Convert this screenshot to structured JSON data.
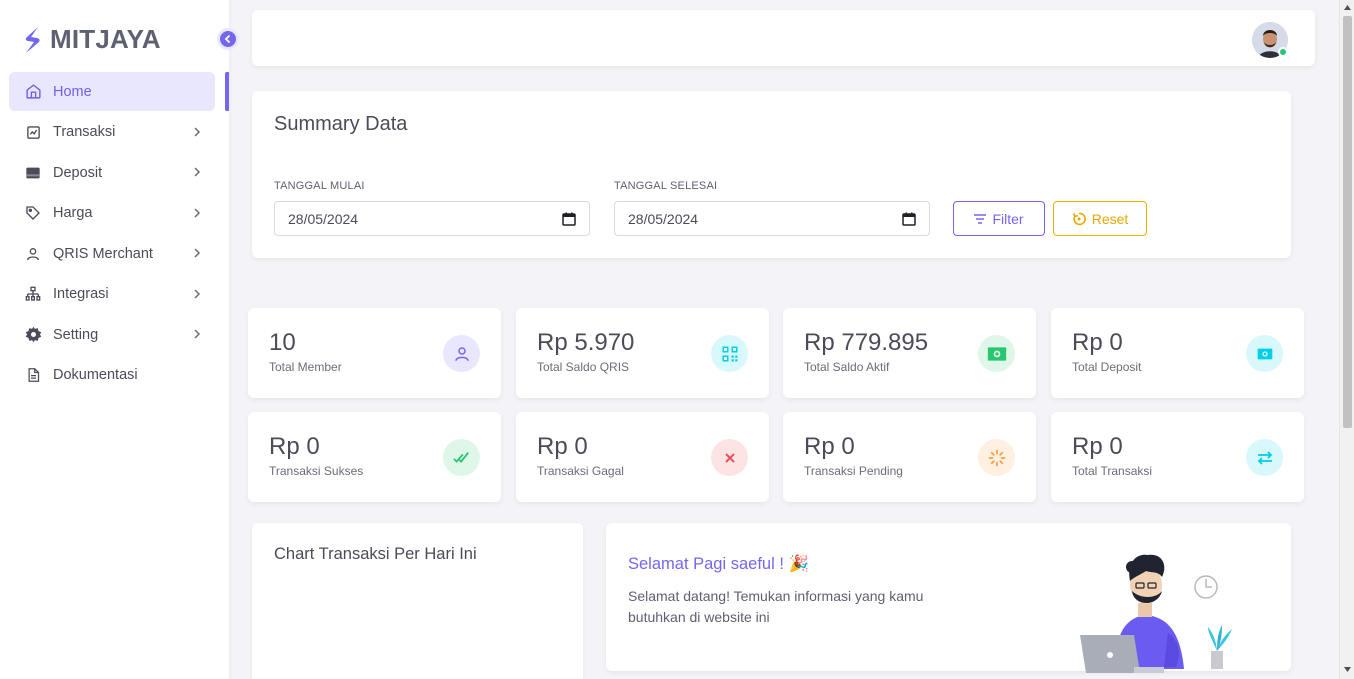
{
  "brand": {
    "name": "MITJAYA"
  },
  "sidebar": {
    "items": [
      {
        "label": "Home",
        "icon": "home-icon",
        "active": true,
        "has_children": false
      },
      {
        "label": "Transaksi",
        "icon": "chart-line-icon",
        "has_children": true
      },
      {
        "label": "Deposit",
        "icon": "wallet-icon",
        "has_children": true
      },
      {
        "label": "Harga",
        "icon": "tag-icon",
        "has_children": true
      },
      {
        "label": "QRIS Merchant",
        "icon": "user-icon",
        "has_children": true
      },
      {
        "label": "Integrasi",
        "icon": "sitemap-icon",
        "has_children": true
      },
      {
        "label": "Setting",
        "icon": "gear-icon",
        "has_children": true
      },
      {
        "label": "Dokumentasi",
        "icon": "document-icon",
        "has_children": false
      }
    ]
  },
  "summary": {
    "title": "Summary Data",
    "start_label": "TANGGAL MULAI",
    "start_value": "28/05/2024",
    "end_label": "TANGGAL SELESAI",
    "end_value": "28/05/2024",
    "filter_label": "Filter",
    "reset_label": "Reset"
  },
  "stats": [
    {
      "value": "10",
      "label": "Total Member",
      "icon": "user-icon",
      "color": "#7367f0",
      "bg": "#e9e7fd"
    },
    {
      "value": "Rp 5.970",
      "label": "Total Saldo QRIS",
      "icon": "qr-code-icon",
      "color": "#00cfe8",
      "bg": "#d9f8fc"
    },
    {
      "value": "Rp 779.895",
      "label": "Total Saldo Aktif",
      "icon": "cash-icon",
      "color": "#28c76f",
      "bg": "#dff7e9"
    },
    {
      "value": "Rp 0",
      "label": "Total Deposit",
      "icon": "cash-icon",
      "color": "#00cfe8",
      "bg": "#d9f8fc"
    },
    {
      "value": "Rp 0",
      "label": "Transaksi Sukses",
      "icon": "double-check-icon",
      "color": "#28c76f",
      "bg": "#dff7e9"
    },
    {
      "value": "Rp 0",
      "label": "Transaksi Gagal",
      "icon": "close-icon",
      "color": "#ea5455",
      "bg": "#fce4e4"
    },
    {
      "value": "Rp 0",
      "label": "Transaksi Pending",
      "icon": "loader-icon",
      "color": "#ff9f43",
      "bg": "#fff0e1"
    },
    {
      "value": "Rp 0",
      "label": "Total Transaksi",
      "icon": "exchange-icon",
      "color": "#00cfe8",
      "bg": "#d9f8fc"
    }
  ],
  "chart": {
    "title": "Chart Transaksi Per Hari Ini"
  },
  "welcome": {
    "title": "Selamat Pagi saeful ! 🎉",
    "text": "Selamat datang! Temukan informasi yang kamu butuhkan di website ini"
  }
}
